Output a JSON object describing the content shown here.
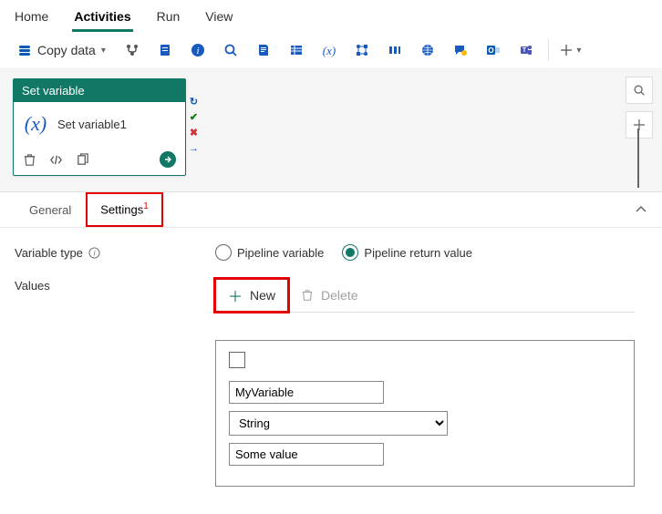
{
  "nav": {
    "items": [
      "Home",
      "Activities",
      "Run",
      "View"
    ],
    "active": "Activities"
  },
  "toolbar": {
    "copy_label": "Copy data",
    "plus_label": ""
  },
  "node": {
    "type_label": "Set variable",
    "name": "Set variable1"
  },
  "canvas": {
    "search_title": "Search",
    "add_title": "Add"
  },
  "tabs": {
    "general": "General",
    "settings": "Settings",
    "badge": "1"
  },
  "settings": {
    "variable_type_label": "Variable type",
    "values_label": "Values",
    "radio_pipeline_variable": "Pipeline variable",
    "radio_return_value": "Pipeline return value",
    "selected_radio": "return_value",
    "new_label": "New",
    "delete_label": "Delete",
    "value_name": "MyVariable",
    "value_type": "String",
    "value_val": "Some value"
  }
}
